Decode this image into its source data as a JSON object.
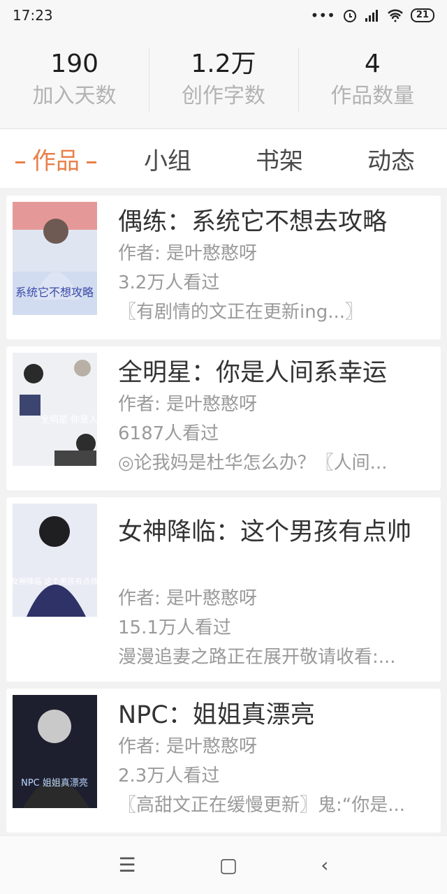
{
  "status": {
    "time": "17:23",
    "battery": "21",
    "icons": [
      "more-dots-icon",
      "alarm-icon",
      "signal-icon",
      "wifi-icon",
      "battery-icon"
    ]
  },
  "stats": [
    {
      "value": "190",
      "label": "加入天数"
    },
    {
      "value": "1.2万",
      "label": "创作字数"
    },
    {
      "value": "4",
      "label": "作品数量"
    }
  ],
  "tabs": [
    {
      "label": "作品"
    },
    {
      "label": "小组"
    },
    {
      "label": "书架"
    },
    {
      "label": "动态"
    }
  ],
  "works": [
    {
      "title": "偶练：系统它不想去攻略",
      "author": "作者: 是叶憨憨呀",
      "views": "3.2万人看过",
      "desc": "〖有剧情的文正在更新ing...〗",
      "cover_text": "系统它不想攻略"
    },
    {
      "title": "全明星：你是人间系幸运",
      "author": "作者: 是叶憨憨呀",
      "views": "6187人看过",
      "desc": "◎论我妈是杜华怎么办？〖人间...",
      "cover_text": "全明星 你是人间系幸运"
    },
    {
      "title": "女神降临：这个男孩有点帅",
      "author": "作者: 是叶憨憨呀",
      "views": "15.1万人看过",
      "desc": "漫漫追妻之路正在展开敬请收看:...",
      "cover_text": "女神降临 这个男孩有点帅"
    },
    {
      "title": "NPC：姐姐真漂亮",
      "author": "作者: 是叶憨憨呀",
      "views": "2.3万人看过",
      "desc": "〖高甜文正在缓慢更新〗鬼:“你是...",
      "cover_text": "NPC 姐姐真漂亮"
    }
  ],
  "nav": {
    "menu": "☰",
    "home": "▢",
    "back": "‹"
  }
}
